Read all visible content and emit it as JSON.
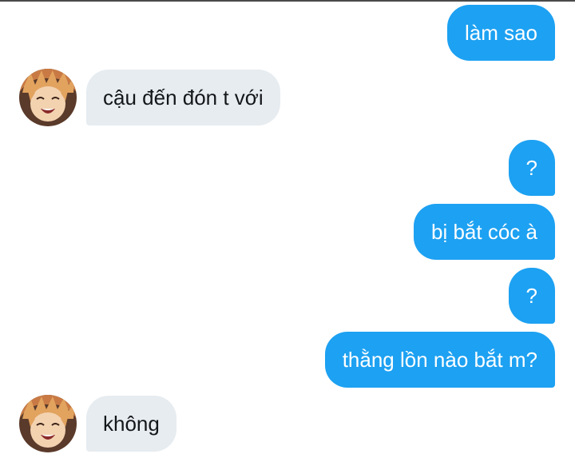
{
  "conversation": {
    "messages": [
      {
        "direction": "sent",
        "text": "làm sao"
      },
      {
        "direction": "received",
        "text": "cậu đến đón t với"
      },
      {
        "direction": "sent",
        "text": "?"
      },
      {
        "direction": "sent",
        "text": "bị bắt cóc à"
      },
      {
        "direction": "sent",
        "text": "?"
      },
      {
        "direction": "sent",
        "text": "thằng lồn nào bắt m?"
      },
      {
        "direction": "received",
        "text": "không"
      }
    ]
  },
  "colors": {
    "sent_bubble": "#1da1f2",
    "received_bubble": "#e6ecf0",
    "sent_text": "#ffffff",
    "received_text": "#14171a"
  },
  "icons": {
    "avatar": "avatar-image"
  }
}
